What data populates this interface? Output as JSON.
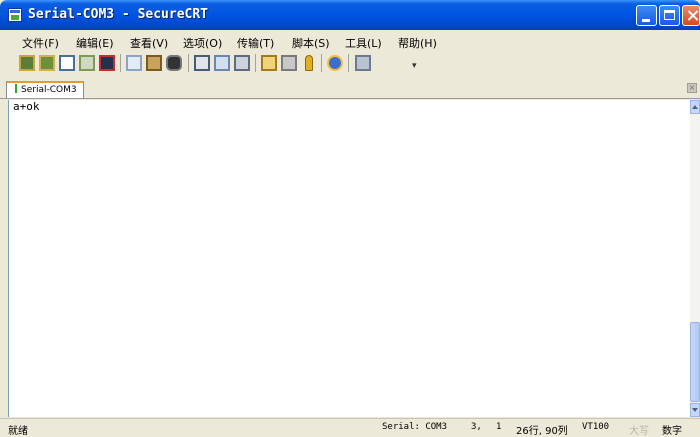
{
  "window": {
    "title": "Serial-COM3 - SecureCRT"
  },
  "menu": [
    {
      "label": "文件(F)"
    },
    {
      "label": "编辑(E)"
    },
    {
      "label": "查看(V)"
    },
    {
      "label": "选项(O)"
    },
    {
      "label": "传输(T)"
    },
    {
      "label": "脚本(S)"
    },
    {
      "label": "工具(L)"
    },
    {
      "label": "帮助(H)"
    }
  ],
  "toolbar": {
    "icons": [
      "connect-icon",
      "quick-connect-icon",
      "connect-in-tab-icon",
      "reconnect-icon",
      "disconnect-icon",
      "copy-icon",
      "paste-icon",
      "find-icon",
      "print-icon",
      "print-screen-icon",
      "print-selection-icon",
      "session-options-icon",
      "global-options-icon",
      "key-map-icon",
      "help-icon",
      "sftp-icon"
    ]
  },
  "tabs": [
    {
      "label": "Serial-COM3",
      "status_color": "#2ea52e"
    }
  ],
  "terminal": {
    "lines": [
      "a+ok"
    ]
  },
  "status": {
    "ready": "就绪",
    "connection": "Serial: COM3",
    "cursor_row": "3,",
    "cursor_col": "1",
    "size": "26行, 90列",
    "emulation": "VT100",
    "caps": "大写",
    "num": "数字"
  },
  "colors": {
    "title_bar": "#0054e3",
    "tab_accent": "#e89a30",
    "background": "#ece9d8"
  }
}
